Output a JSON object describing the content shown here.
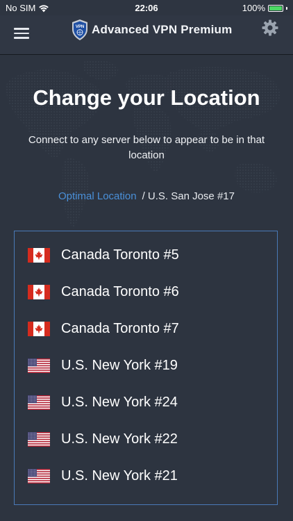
{
  "status_bar": {
    "carrier": "No SIM",
    "time": "22:06",
    "battery_percent": "100%",
    "battery_level": 1.0
  },
  "header": {
    "logo_text": "VPN",
    "title": "Advanced VPN Premium",
    "menu_icon": "hamburger-menu-icon",
    "settings_icon": "gear-icon"
  },
  "main": {
    "title": "Change your Location",
    "subtitle": "Connect to any server below to appear to be in that location",
    "optimal_location_label": "Optimal Location",
    "current_server": "/ U.S. San Jose #17"
  },
  "servers": [
    {
      "name": "Canada Toronto #5",
      "flag": "canada"
    },
    {
      "name": "Canada Toronto #6",
      "flag": "canada"
    },
    {
      "name": "Canada Toronto #7",
      "flag": "canada"
    },
    {
      "name": "U.S. New York #19",
      "flag": "usa"
    },
    {
      "name": "U.S. New York #24",
      "flag": "usa"
    },
    {
      "name": "U.S. New York #22",
      "flag": "usa"
    },
    {
      "name": "U.S. New York #21",
      "flag": "usa"
    }
  ],
  "colors": {
    "background": "#2d3440",
    "link": "#4a90d9",
    "list_border": "#4a7ab8",
    "battery": "#4cd964"
  }
}
